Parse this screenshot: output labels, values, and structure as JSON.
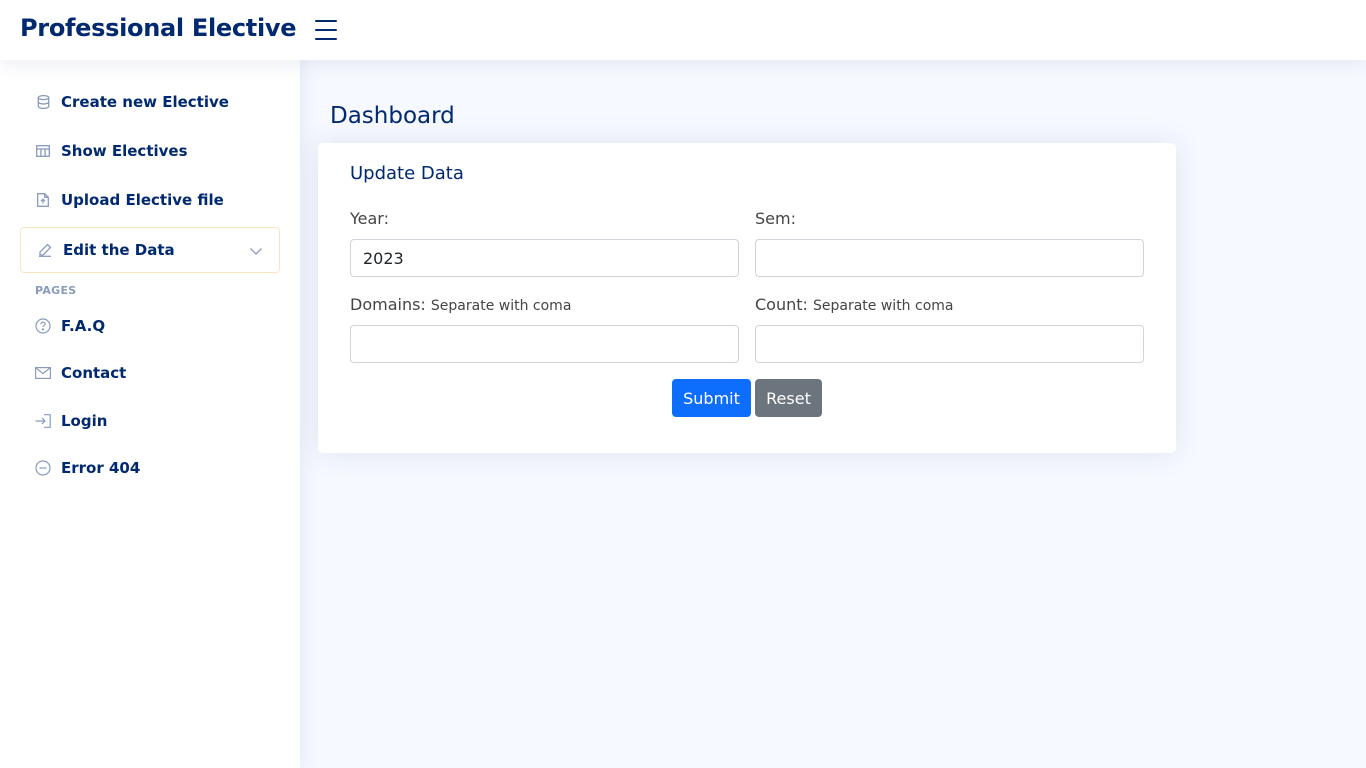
{
  "header": {
    "brand": "Professional Elective",
    "menu_icon": "hamburger-icon"
  },
  "sidebar": {
    "items": [
      {
        "label": "Create new Elective",
        "icon": "database-icon"
      },
      {
        "label": "Show Electives",
        "icon": "table-icon"
      },
      {
        "label": "Upload Elective file",
        "icon": "file-upload-icon"
      },
      {
        "label": "Edit the Data",
        "icon": "pencil-icon",
        "active": true
      }
    ],
    "pages_heading": "PAGES",
    "pages": [
      {
        "label": "F.A.Q",
        "icon": "question-circle-icon"
      },
      {
        "label": "Contact",
        "icon": "envelope-icon"
      },
      {
        "label": "Login",
        "icon": "login-icon"
      },
      {
        "label": "Error 404",
        "icon": "dash-circle-icon"
      }
    ]
  },
  "main": {
    "page_title": "Dashboard",
    "card": {
      "title": "Update Data",
      "year_label": "Year:",
      "year_value": "2023",
      "sem_label": "Sem:",
      "sem_value": "",
      "domains_label": "Domains:",
      "domains_hint": "Separate with coma",
      "domains_value": "",
      "count_label": "Count:",
      "count_hint": "Separate with coma",
      "count_value": "",
      "submit_label": "Submit",
      "reset_label": "Reset"
    }
  },
  "colors": {
    "brand": "#012970",
    "primary_button": "#0d6efd",
    "secondary_button": "#6c757d",
    "page_background": "#f6f9ff",
    "active_border": "#f9e6bd"
  }
}
